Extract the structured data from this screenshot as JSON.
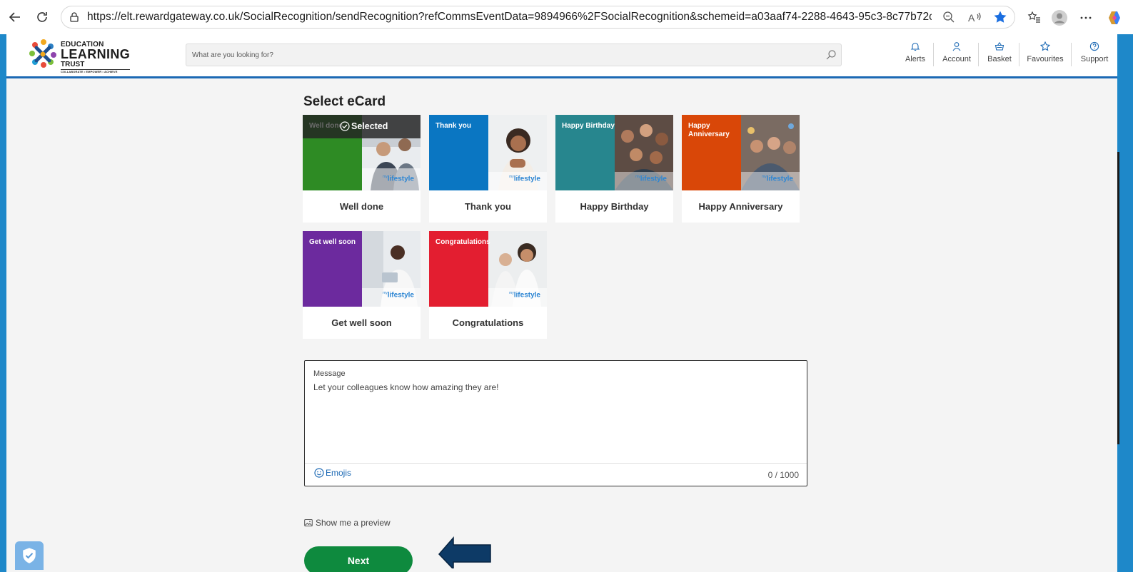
{
  "browser": {
    "url": "https://elt.rewardgateway.co.uk/SocialRecognition/sendRecognition?refCommsEventData=9894966%2FSocialRecognition&schemeid=a03aaf74-2288-4643-95c3-8c77b72c9460&segmenti..."
  },
  "header": {
    "logo": {
      "line1": "EDUCATION",
      "line2": "LEARNING",
      "line3": "TRUST",
      "tagline": "COLLABORATE • EMPOWER • ACHIEVE"
    },
    "search_placeholder": "What are you looking for?",
    "nav": [
      {
        "label": "Alerts",
        "icon": "bell-icon"
      },
      {
        "label": "Account",
        "icon": "user-icon"
      },
      {
        "label": "Basket",
        "icon": "basket-icon"
      },
      {
        "label": "Favourites",
        "icon": "star-icon"
      },
      {
        "label": "Support",
        "icon": "help-icon"
      }
    ]
  },
  "main": {
    "section_title": "Select eCard",
    "selected_label": "Selected",
    "brand_prefix": "my",
    "brand_name": "lifestyle",
    "cards": [
      {
        "title": "Well done",
        "caption": "Well done",
        "color": "#2e8b24",
        "selected": true
      },
      {
        "title": "Thank you",
        "caption": "Thank you",
        "color": "#0a76c2",
        "selected": false
      },
      {
        "title": "Happy Birthday",
        "caption": "Happy Birthday",
        "color": "#27868e",
        "selected": false
      },
      {
        "title": "Happy Anniversary",
        "caption": "Happy Anniversary",
        "color": "#d94708",
        "selected": false
      },
      {
        "title": "Get well soon",
        "caption": "Get well soon",
        "color": "#6c2a9e",
        "selected": false
      },
      {
        "title": "Congratulations",
        "caption": "Congratulations",
        "color": "#e31e30",
        "selected": false
      }
    ],
    "message": {
      "label": "Message",
      "placeholder": "Let your colleagues know how amazing they are!",
      "emoji_label": "Emojis",
      "char_count": "0 / 1000"
    },
    "preview_label": "Show me a preview",
    "next_label": "Next"
  },
  "colors": {
    "accent_blue": "#1c69b4",
    "next_green": "#0e8a3e",
    "arrow_navy": "#0d3a66"
  }
}
